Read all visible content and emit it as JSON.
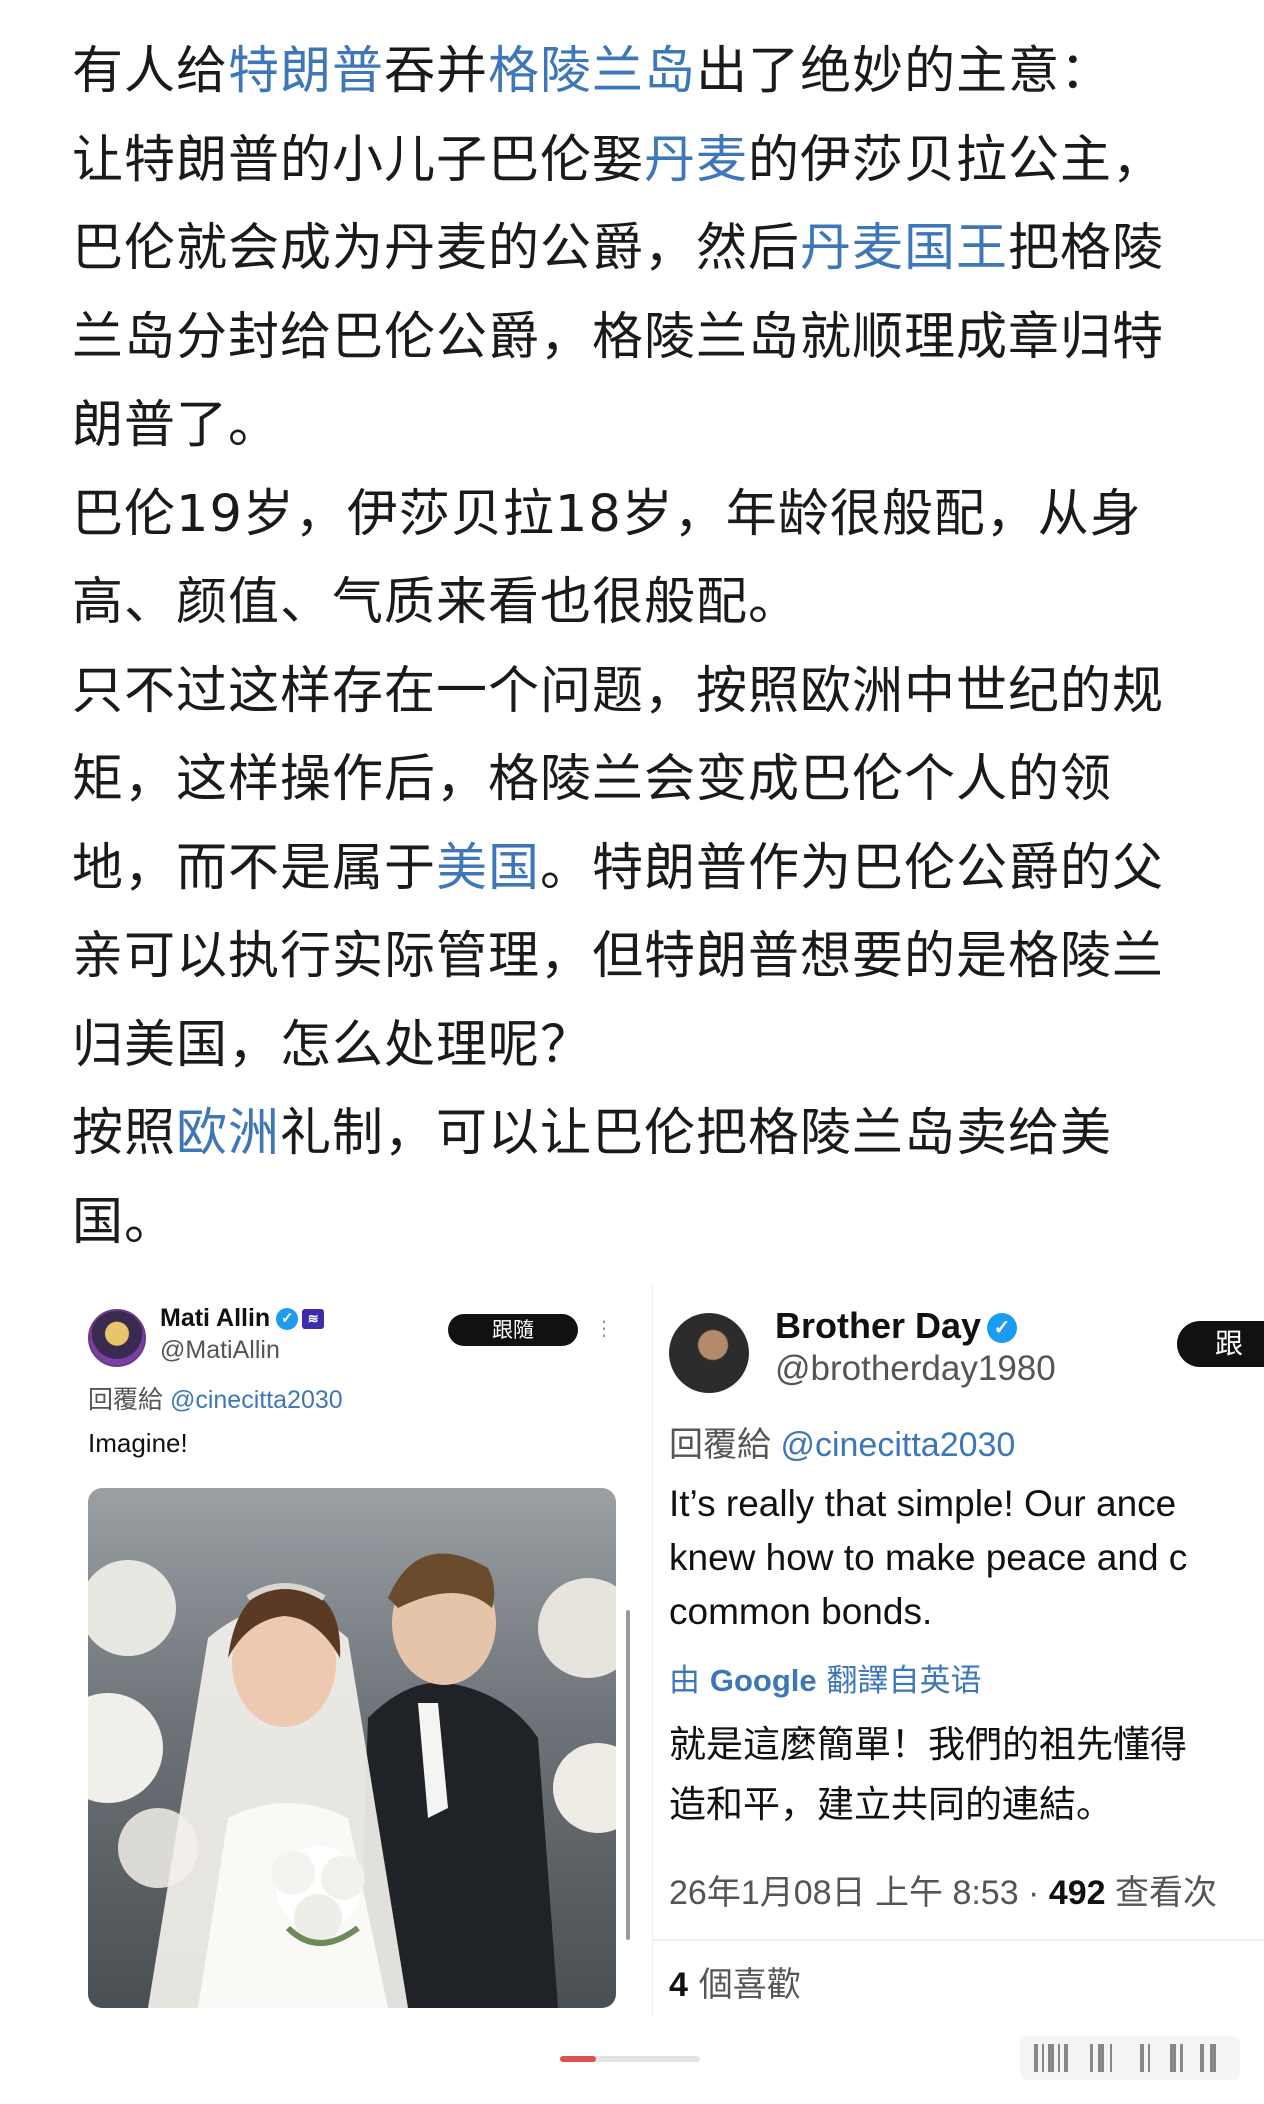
{
  "post": {
    "paragraphs": [
      [
        {
          "t": "有人给",
          "link": false
        },
        {
          "t": "特朗普",
          "link": true
        },
        {
          "t": "吞并",
          "link": false
        },
        {
          "t": "格陵兰岛",
          "link": true
        },
        {
          "t": "出了绝妙的主意：",
          "link": false
        }
      ],
      [
        {
          "t": "让特朗普的小儿子巴伦娶",
          "link": false
        },
        {
          "t": "丹麦",
          "link": true
        },
        {
          "t": "的伊莎贝拉公主，巴伦就会成为丹麦的公爵，然后",
          "link": false
        },
        {
          "t": "丹麦国王",
          "link": true
        },
        {
          "t": "把格陵兰岛分封给巴伦公爵，格陵兰岛就顺理成章归特朗普了。",
          "link": false
        }
      ],
      [
        {
          "t": "巴伦19岁，伊莎贝拉18岁，年龄很般配，从身高、颜值、气质来看也很般配。",
          "link": false
        }
      ],
      [
        {
          "t": "只不过这样存在一个问题，按照欧洲中世纪的规矩，这样操作后，格陵兰会变成巴伦个人的领地，而不是属于",
          "link": false
        },
        {
          "t": "美国",
          "link": true
        },
        {
          "t": "。特朗普作为巴伦公爵的父亲可以执行实际管理，但特朗普想要的是格陵兰归美国，怎么处理呢？",
          "link": false
        }
      ],
      [
        {
          "t": "按照",
          "link": false
        },
        {
          "t": "欧洲",
          "link": true
        },
        {
          "t": "礼制，可以让巴伦把格陵兰岛卖给美国。",
          "link": false
        }
      ]
    ]
  },
  "tweet_left": {
    "display_name": "Mati Allin",
    "handle": "@MatiAllin",
    "follow_label": "跟隨",
    "more_icon": "⋮",
    "reply_prefix": "回覆給",
    "reply_handle": "@cinecitta2030",
    "text": "Imagine!"
  },
  "tweet_right": {
    "display_name": "Brother Day",
    "handle": "@brotherday1980",
    "follow_label": "跟",
    "reply_prefix": "回覆給",
    "reply_handle": "@cinecitta2030",
    "text_en_lines": [
      "It’s really that simple! Our ance",
      "knew how to make peace and c",
      "common bonds."
    ],
    "translate_prefix": "由",
    "translate_brand": "Google",
    "translate_suffix": "翻譯自英语",
    "text_zh_lines": [
      "就是這麼簡單！我們的祖先懂得",
      "造和平，建立共同的連結。"
    ],
    "meta_time": "26年1月08日 上午 8:53 · ",
    "meta_views": "492",
    "meta_views_label": " 查看次",
    "likes_count": "4",
    "likes_label": " 個喜歡"
  },
  "colors": {
    "link": "#3d77b8",
    "verified": "#1d9bf0",
    "follow_bg": "#111111",
    "pager_active": "#e05050"
  }
}
